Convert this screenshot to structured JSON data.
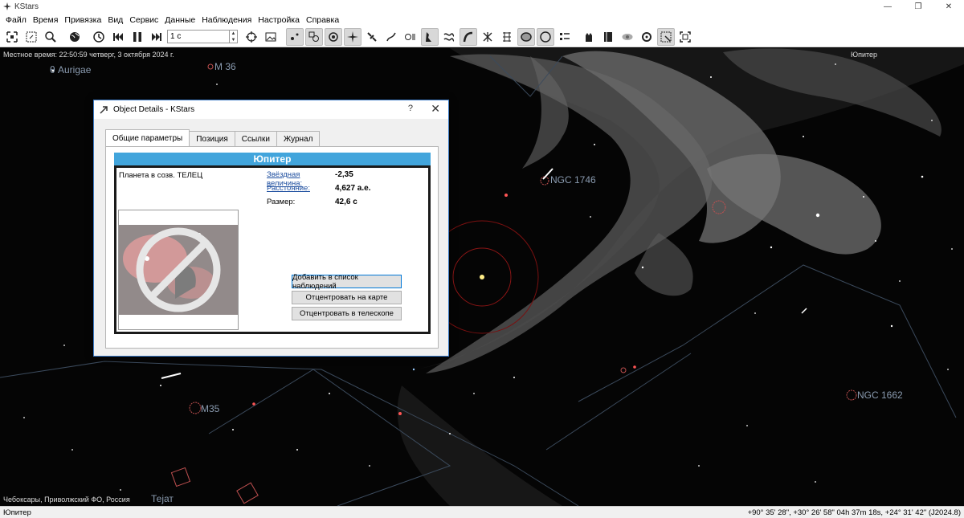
{
  "window": {
    "title": "KStars",
    "minimize": "—",
    "maximize": "❐",
    "close": "✕"
  },
  "menu": [
    "Файл",
    "Время",
    "Привязка",
    "Вид",
    "Сервис",
    "Данные",
    "Наблюдения",
    "Настройка",
    "Справка"
  ],
  "toolbar": {
    "time_step": "1 с"
  },
  "hud": {
    "local_time": "Местное время: 22:50:59   четверг, 3 октября 2024 г.",
    "focus_object": "Юпитер",
    "location": "Чебоксары, Приволжский ФО, Россия"
  },
  "sky_labels": {
    "aurigae": "θ Aurigae",
    "m36": "M 36",
    "ngc1746": "NGC 1746",
    "ngc1662": "NGC 1662",
    "m35": "M35",
    "tejat": "Тејат"
  },
  "statusbar": {
    "object": "Юпитер",
    "coords": "+90° 35' 28\", +30° 26' 58\"  04h 37m 18s, +24° 31' 42\" (J2024.8)"
  },
  "dialog": {
    "title": "Object Details - KStars",
    "help": "?",
    "close": "✕",
    "tabs": [
      "Общие параметры",
      "Позиция",
      "Ссылки",
      "Журнал"
    ],
    "object_name": "Юпитер",
    "object_type": "Планета в созв. ТЕЛЕЦ",
    "properties": [
      {
        "label": "Звёздная величина:",
        "value": "-2,35"
      },
      {
        "label": "Расстояние:",
        "value": "4,627 а.е."
      },
      {
        "label": "Размер:",
        "value": "42,6 с"
      }
    ],
    "buttons": {
      "add_observing": "Добавить в список наблюдений",
      "center_map": "Отцентровать на карте",
      "center_telescope": "Отцентровать в телескопе"
    }
  }
}
